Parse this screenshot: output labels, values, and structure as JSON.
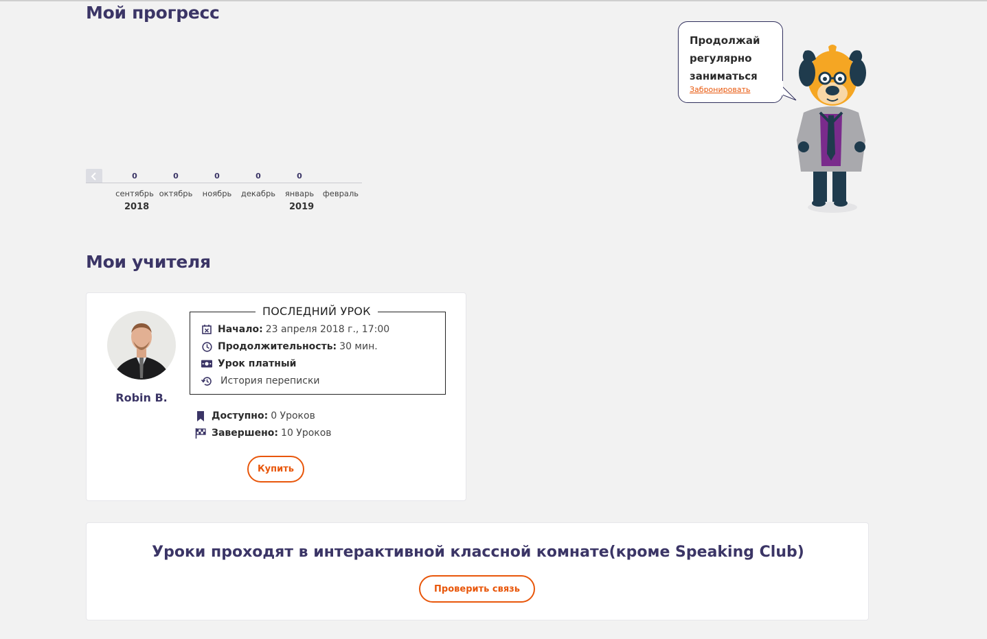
{
  "progress": {
    "title": "Мой прогресс",
    "months": [
      {
        "label": "сентябрь",
        "count": "0"
      },
      {
        "label": "октябрь",
        "count": "0"
      },
      {
        "label": "ноябрь",
        "count": "0"
      },
      {
        "label": "декабрь",
        "count": "0"
      },
      {
        "label": "январь",
        "count": "0"
      },
      {
        "label": "февраль",
        "count": ""
      }
    ],
    "years": [
      "2018",
      "2019"
    ]
  },
  "bubble": {
    "line1": "Продолжай",
    "line2": "регулярно",
    "line3": "заниматься",
    "link": "Забронировать"
  },
  "teachers": {
    "title": "Мои учителя",
    "teacher_name": "Robin B.",
    "last_lesson": {
      "title": "ПОСЛЕДНИЙ УРОК",
      "start_label": "Начало:",
      "start_value": "23 апреля 2018 г., 17:00",
      "duration_label": "Продолжительность:",
      "duration_value": "30 мин.",
      "paid_label": "Урок платный",
      "history_label": "История переписки"
    },
    "available_label": "Доступно:",
    "available_value": "0 Уроков",
    "completed_label": "Завершено:",
    "completed_value": "10 Уроков",
    "buy_button": "Купить"
  },
  "room": {
    "title": "Уроки проходят в интерактивной классной комнате(кроме Speaking Club)",
    "check_button": "Проверить связь"
  },
  "colors": {
    "accent": "#e8560a",
    "heading": "#3b3566",
    "background": "#f2f2f2"
  },
  "icons": [
    "calendar-icon",
    "clock-icon",
    "money-icon",
    "history-icon",
    "bookmark-icon",
    "checkered-flag-icon",
    "chevron-left-icon"
  ]
}
